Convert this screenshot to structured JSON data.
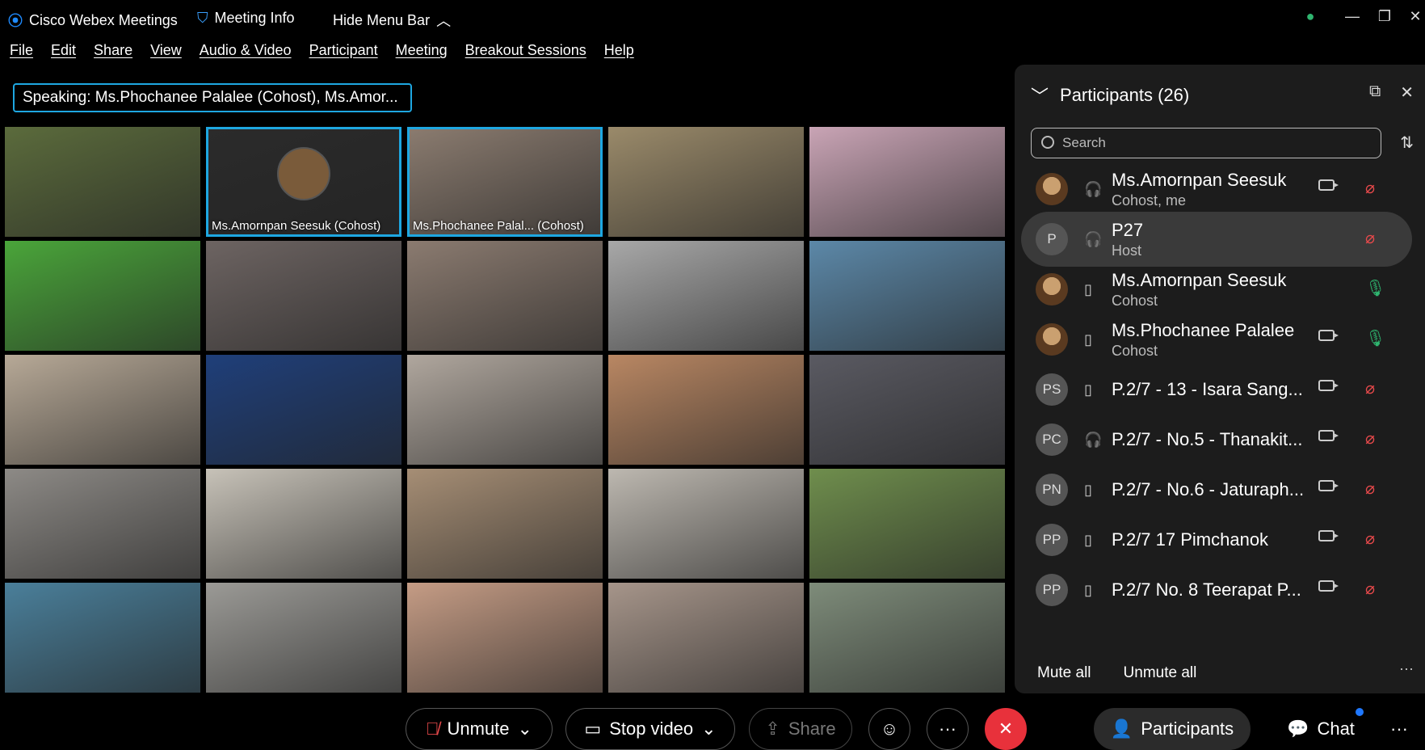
{
  "titlebar": {
    "app_name": "Cisco Webex Meetings",
    "meeting_info": "Meeting Info",
    "hide_menu_bar": "Hide Menu Bar"
  },
  "menu": [
    "File",
    "Edit",
    "Share",
    "View",
    "Audio & Video",
    "Participant",
    "Meeting",
    "Breakout Sessions",
    "Help"
  ],
  "speaking": {
    "label": "Speaking:",
    "names": "Ms.Phochanee Palalee (Cohost), Ms.Amor..."
  },
  "tiles": [
    {
      "name": "",
      "bg": "#5b6b3c",
      "active": false
    },
    {
      "name": "Ms.Amornpan Seesuk  (Cohost)",
      "bg": "#2b2b2b",
      "active": true,
      "avatar": true
    },
    {
      "name": "Ms.Phochanee Palal...   (Cohost)",
      "bg": "#8a7b6f",
      "active": true
    },
    {
      "name": "",
      "bg": "#9a8a6a",
      "active": false
    },
    {
      "name": "",
      "bg": "#c9a4b5",
      "active": false
    },
    {
      "name": "",
      "bg": "#4aa53a",
      "active": false
    },
    {
      "name": "",
      "bg": "#6d6462",
      "active": false
    },
    {
      "name": "",
      "bg": "#8b7b70",
      "active": false
    },
    {
      "name": "",
      "bg": "#a8a8a8",
      "active": false
    },
    {
      "name": "",
      "bg": "#5c88a8",
      "active": false
    },
    {
      "name": "",
      "bg": "#b7a997",
      "active": false
    },
    {
      "name": "",
      "bg": "#1f3f7a",
      "active": false
    },
    {
      "name": "",
      "bg": "#b0a79e",
      "active": false
    },
    {
      "name": "",
      "bg": "#b98763",
      "active": false
    },
    {
      "name": "",
      "bg": "#5a5a62",
      "active": false
    },
    {
      "name": "",
      "bg": "#8d8a86",
      "active": false
    },
    {
      "name": "",
      "bg": "#c7c2b8",
      "active": false
    },
    {
      "name": "",
      "bg": "#a68e75",
      "active": false
    },
    {
      "name": "",
      "bg": "#bdb8b0",
      "active": false
    },
    {
      "name": "",
      "bg": "#6f8e4d",
      "active": false
    },
    {
      "name": "",
      "bg": "#4a7f9a",
      "active": false
    },
    {
      "name": "",
      "bg": "#9b9a96",
      "active": false
    },
    {
      "name": "",
      "bg": "#c59c85",
      "active": false
    },
    {
      "name": "",
      "bg": "#a6958a",
      "active": false
    },
    {
      "name": "",
      "bg": "#7e8c7a",
      "active": false
    }
  ],
  "participants_panel": {
    "title": "Participants (26)",
    "search_placeholder": "Search",
    "rows": [
      {
        "initials": "",
        "photo": true,
        "name": "Ms.Amornpan Seesuk",
        "role": "Cohost, me",
        "device": "headset-icon",
        "camera": true,
        "mic": "off"
      },
      {
        "initials": "P",
        "photo": false,
        "name": "P27",
        "role": "Host",
        "device": "headset-icon",
        "camera": false,
        "mic": "off",
        "selected": true
      },
      {
        "initials": "",
        "photo": true,
        "name": "Ms.Amornpan Seesuk",
        "role": "Cohost",
        "device": "phone-icon",
        "camera": false,
        "mic": "on"
      },
      {
        "initials": "",
        "photo": true,
        "name": "Ms.Phochanee Palalee",
        "role": "Cohost",
        "device": "phone-icon",
        "camera": true,
        "mic": "on"
      },
      {
        "initials": "PS",
        "photo": false,
        "name": "P.2/7 - 13 - Isara Sang...",
        "role": "",
        "device": "phone-icon",
        "camera": true,
        "mic": "off"
      },
      {
        "initials": "PC",
        "photo": false,
        "name": "P.2/7 - No.5 - Thanakit...",
        "role": "",
        "device": "headset-icon",
        "camera": true,
        "mic": "off"
      },
      {
        "initials": "PN",
        "photo": false,
        "name": "P.2/7 - No.6 - Jaturaph...",
        "role": "",
        "device": "phone-icon",
        "camera": true,
        "mic": "off"
      },
      {
        "initials": "PP",
        "photo": false,
        "name": "P.2/7 17 Pimchanok",
        "role": "",
        "device": "phone-icon",
        "camera": true,
        "mic": "off"
      },
      {
        "initials": "PP",
        "photo": false,
        "name": "P.2/7 No. 8 Teerapat P...",
        "role": "",
        "device": "phone-icon",
        "camera": true,
        "mic": "off"
      }
    ],
    "mute_all": "Mute all",
    "unmute_all": "Unmute all"
  },
  "controls": {
    "unmute": "Unmute",
    "stop_video": "Stop video",
    "share": "Share",
    "participants": "Participants",
    "chat": "Chat"
  }
}
